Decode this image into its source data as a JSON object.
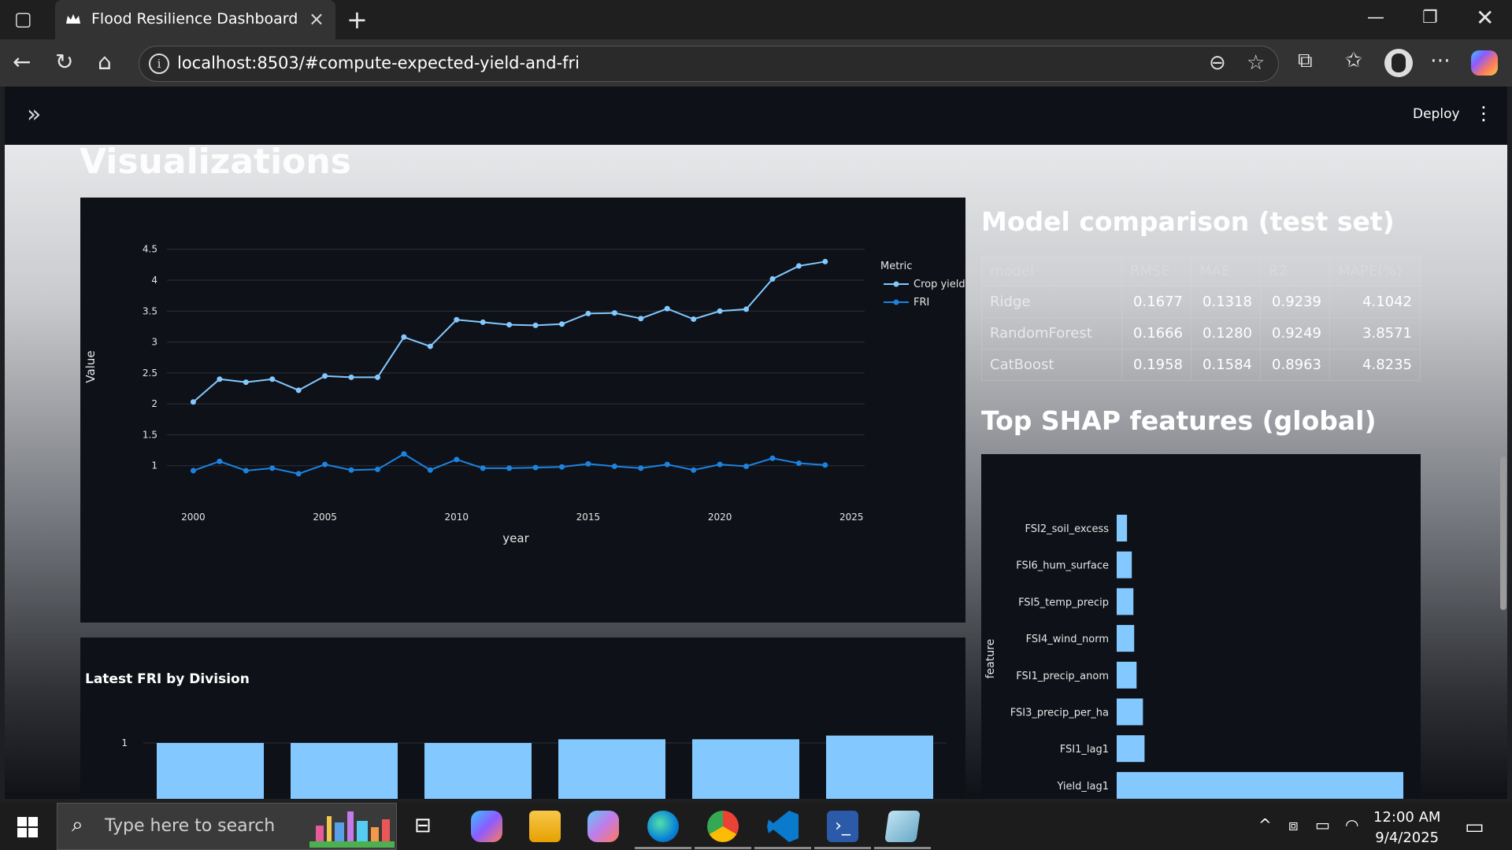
{
  "browser": {
    "tab_title": "Flood Resilience Dashboard",
    "url": "localhost:8503/#compute-expected-yield-and-fri"
  },
  "app": {
    "deploy_label": "Deploy",
    "section_title": "Visualizations"
  },
  "model_comparison": {
    "title": "Model comparison (test set)",
    "columns": [
      "model",
      "RMSE",
      "MAE",
      "R2",
      "MAPE(%)"
    ],
    "rows": [
      [
        "Ridge",
        "0.1677",
        "0.1318",
        "0.9239",
        "4.1042"
      ],
      [
        "RandomForest",
        "0.1666",
        "0.1280",
        "0.9249",
        "3.8571"
      ],
      [
        "CatBoost",
        "0.1958",
        "0.1584",
        "0.8963",
        "4.8235"
      ]
    ]
  },
  "shap_title": "Top SHAP features (global)",
  "taskbar": {
    "search_placeholder": "Type here to search",
    "time": "12:00 AM",
    "date": "9/4/2025"
  },
  "chart_data": [
    {
      "type": "line",
      "title": "",
      "xlabel": "year",
      "ylabel": "Value",
      "legend_title": "Metric",
      "legend_position": "top-right",
      "xlim": [
        1999,
        2025.5
      ],
      "ylim": [
        0.5,
        4.7
      ],
      "xticks": [
        "2000",
        "2005",
        "2010",
        "2015",
        "2020",
        "2025"
      ],
      "yticks": [
        "1",
        "1.5",
        "2",
        "2.5",
        "3",
        "3.5",
        "4",
        "4.5"
      ],
      "grid": true,
      "x": [
        2000,
        2001,
        2002,
        2003,
        2004,
        2005,
        2006,
        2007,
        2008,
        2009,
        2010,
        2011,
        2012,
        2013,
        2014,
        2015,
        2016,
        2017,
        2018,
        2019,
        2020,
        2021,
        2022,
        2023,
        2024
      ],
      "series": [
        {
          "name": "Crop yield",
          "color": "#83c9ff",
          "values": [
            2.03,
            2.4,
            2.35,
            2.4,
            2.22,
            2.45,
            2.43,
            2.43,
            3.08,
            2.93,
            3.36,
            3.32,
            3.28,
            3.27,
            3.29,
            3.46,
            3.47,
            3.38,
            3.54,
            3.37,
            3.5,
            3.53,
            4.02,
            4.23,
            4.3
          ]
        },
        {
          "name": "FRI",
          "color": "#1c83e1",
          "values": [
            0.92,
            1.07,
            0.92,
            0.96,
            0.87,
            1.02,
            0.93,
            0.94,
            1.19,
            0.93,
            1.1,
            0.96,
            0.96,
            0.97,
            0.98,
            1.03,
            0.99,
            0.96,
            1.02,
            0.93,
            1.02,
            0.99,
            1.12,
            1.04,
            1.01
          ]
        }
      ]
    },
    {
      "type": "bar",
      "orientation": "horizontal",
      "xlabel": "",
      "ylabel": "feature",
      "color": "#83c9ff",
      "categories": [
        "FSI2_soil_excess",
        "FSI6_hum_surface",
        "FSI5_temp_precip",
        "FSI4_wind_norm",
        "FSI1_precip_anom",
        "FSI3_precip_per_ha",
        "FSI1_lag1",
        "Yield_lag1"
      ],
      "values": [
        0.013,
        0.019,
        0.021,
        0.022,
        0.025,
        0.033,
        0.035,
        0.36
      ]
    },
    {
      "type": "bar",
      "title": "Latest FRI by Division",
      "color": "#83c9ff",
      "yticks": [
        "0.8",
        "1"
      ],
      "values": [
        1.0,
        1.0,
        1.0,
        1.01,
        1.01,
        1.02
      ]
    }
  ]
}
